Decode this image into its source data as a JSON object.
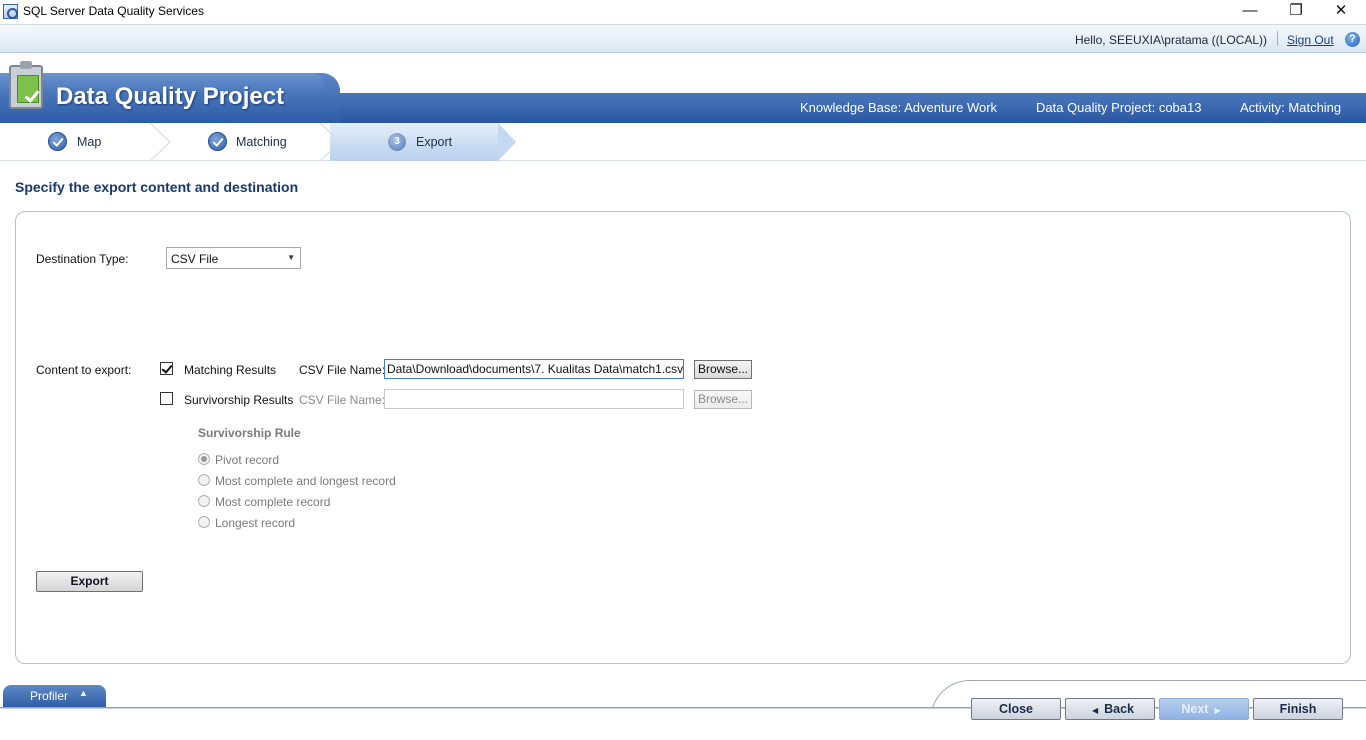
{
  "window": {
    "title": "SQL Server Data Quality Services",
    "controls": {
      "minimize": "—",
      "maximize": "❐",
      "close": "✕"
    }
  },
  "userbar": {
    "greeting": "Hello, SEEUXIA\\pratama ((LOCAL))",
    "sign_out": "Sign Out",
    "help_icon": "?"
  },
  "banner": {
    "title": "Data Quality Project",
    "knowledge_base": "Knowledge Base: Adventure Work",
    "project": "Data Quality Project: coba13",
    "activity": "Activity: Matching"
  },
  "steps": [
    {
      "label": "Map",
      "state": "done"
    },
    {
      "label": "Matching",
      "state": "done"
    },
    {
      "label": "Export",
      "state": "active",
      "number": "3"
    }
  ],
  "page": {
    "heading": "Specify the export content and destination"
  },
  "destination": {
    "label": "Destination Type:",
    "selected": "CSV File"
  },
  "content": {
    "label": "Content to export:",
    "matching": {
      "label": "Matching Results",
      "checked": true,
      "csv_label": "CSV File Name:",
      "csv_value": "Data\\Download\\documents\\7. Kualitas Data\\match1.csv",
      "browse": "Browse..."
    },
    "survivorship": {
      "label": "Survivorship Results",
      "checked": false,
      "csv_label": "CSV File Name:",
      "csv_value": "",
      "browse": "Browse..."
    }
  },
  "survivorship_rule": {
    "title": "Survivorship Rule",
    "options": [
      {
        "label": "Pivot record",
        "selected": true
      },
      {
        "label": "Most complete and longest record",
        "selected": false
      },
      {
        "label": "Most complete record",
        "selected": false
      },
      {
        "label": "Longest record",
        "selected": false
      }
    ]
  },
  "export_button": "Export",
  "profiler": {
    "label": "Profiler",
    "arrow": "▲"
  },
  "nav": {
    "close": "Close",
    "back": "Back",
    "next": "Next",
    "finish": "Finish",
    "back_arrow": "◀",
    "next_arrow": "▶"
  },
  "colors": {
    "banner_blue": "#2e5da8",
    "heading_blue": "#17386e",
    "active_step": "#c5d8f1"
  }
}
